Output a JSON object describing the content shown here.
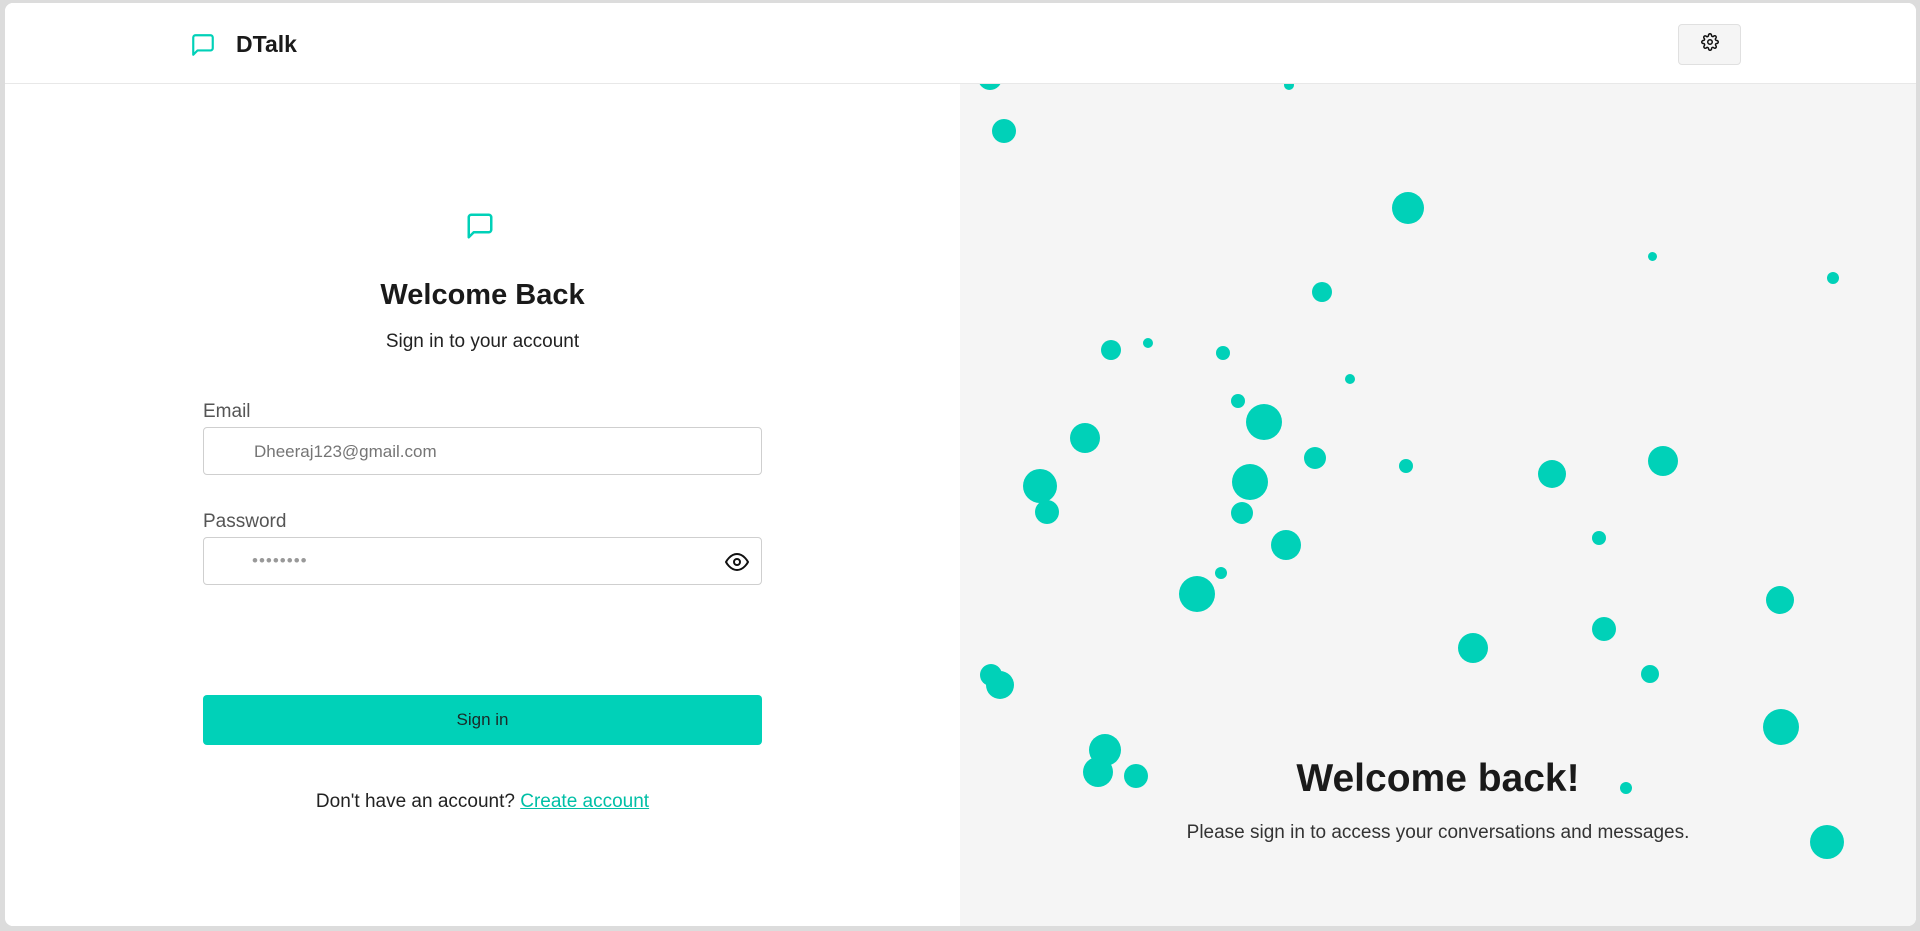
{
  "nav": {
    "brand_name": "DTalk",
    "brand_icon": "message-square-icon",
    "settings_icon": "gear-icon"
  },
  "login": {
    "icon": "message-square-icon",
    "title": "Welcome Back",
    "subtitle": "Sign in to your account",
    "email_label": "Email",
    "email_placeholder": "Dheeraj123@gmail.com",
    "email_icon": "mail-icon",
    "password_label": "Password",
    "password_placeholder": "••••••••",
    "password_icon": "lock-icon",
    "show_password_icon": "eye-icon",
    "signin_label": "Sign in",
    "no_account_text": "Don't have an account?",
    "create_account_link": "Create account"
  },
  "hero": {
    "title": "Welcome back!",
    "subtitle": "Please sign in to access your conversations and messages."
  },
  "colors": {
    "accent": "#00d1b8",
    "hero_background": "#f5f5f5"
  }
}
